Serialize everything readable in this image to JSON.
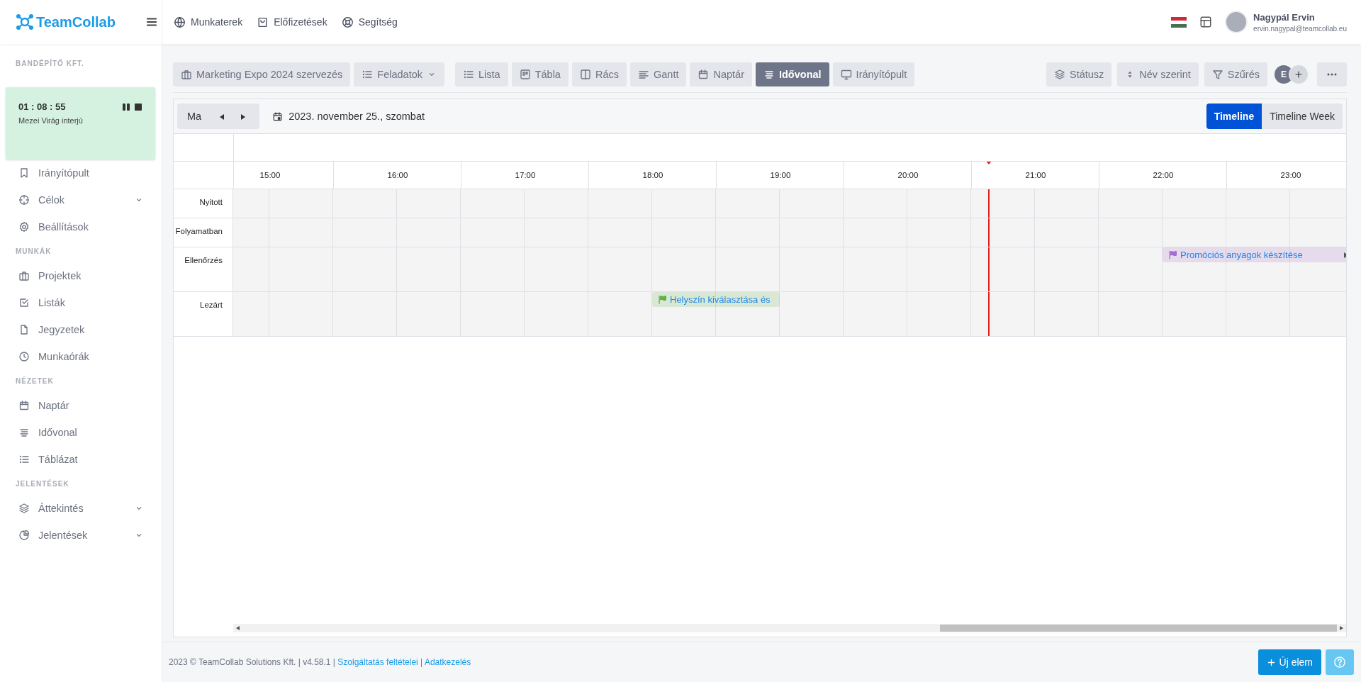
{
  "header": {
    "logo": "TeamCollab",
    "nav": [
      "Munkaterek",
      "Előfizetések",
      "Segítség"
    ],
    "user": {
      "name": "Nagypál Ervin",
      "email": "ervin.nagypal@teamcollab.eu"
    }
  },
  "sidebar": {
    "org": "BANDÉPÍTŐ KFT.",
    "timer": {
      "time": "01 : 08 : 55",
      "task": "Mezei Virág interjú"
    },
    "sections": [
      {
        "items": [
          {
            "label": "Irányítópult",
            "has_submenu": false
          },
          {
            "label": "Célok",
            "has_submenu": true
          },
          {
            "label": "Beállítások",
            "has_submenu": false
          }
        ]
      },
      {
        "title": "MUNKÁK",
        "items": [
          {
            "label": "Projektek",
            "has_submenu": false
          },
          {
            "label": "Listák",
            "has_submenu": false
          },
          {
            "label": "Jegyzetek",
            "has_submenu": false
          },
          {
            "label": "Munkaórák",
            "has_submenu": false
          }
        ]
      },
      {
        "title": "NÉZETEK",
        "items": [
          {
            "label": "Naptár",
            "has_submenu": false
          },
          {
            "label": "Idővonal",
            "has_submenu": false
          },
          {
            "label": "Táblázat",
            "has_submenu": false
          }
        ]
      },
      {
        "title": "JELENTÉSEK",
        "items": [
          {
            "label": "Áttekintés",
            "has_submenu": true
          },
          {
            "label": "Jelentések",
            "has_submenu": true
          }
        ]
      }
    ]
  },
  "toolbar": {
    "project": "Marketing Expo 2024 szervezés",
    "type_menu": "Feladatok",
    "views": [
      {
        "label": "Lista",
        "selected": false
      },
      {
        "label": "Tábla",
        "selected": false
      },
      {
        "label": "Rács",
        "selected": false
      },
      {
        "label": "Gantt",
        "selected": false
      },
      {
        "label": "Naptár",
        "selected": false
      },
      {
        "label": "Idővonal",
        "selected": true
      },
      {
        "label": "Irányítópult",
        "selected": false
      }
    ],
    "actions": [
      "Státusz",
      "Név szerint",
      "Szűrés"
    ],
    "member_initial": "E"
  },
  "calendar": {
    "today": "Ma",
    "date": "2023. november 25., szombat",
    "modes": [
      {
        "label": "Timeline",
        "selected": true
      },
      {
        "label": "Timeline Week",
        "selected": false
      }
    ],
    "hours": [
      "15:00",
      "16:00",
      "17:00",
      "18:00",
      "19:00",
      "20:00",
      "21:00",
      "22:00",
      "23:00"
    ],
    "rows": [
      {
        "label": "Nyitott",
        "events": []
      },
      {
        "label": "Folyamatban",
        "events": []
      },
      {
        "label": "Ellenőrzés",
        "events": [
          {
            "title": "Promóciós anyagok készítése",
            "color": "#a56ccf",
            "continues": true
          }
        ]
      },
      {
        "label": "Lezárt",
        "events": [
          {
            "title": "Helyszín kiválasztása és",
            "color": "#5fb247",
            "continues": false
          }
        ]
      }
    ]
  },
  "footer": {
    "text": "2023 © TeamCollab Solutions Kft. | v4.58.1 |",
    "links": [
      "Szolgáltatás feltételei",
      "Adatkezelés"
    ],
    "separator": "|",
    "new_button": "Új elem"
  }
}
